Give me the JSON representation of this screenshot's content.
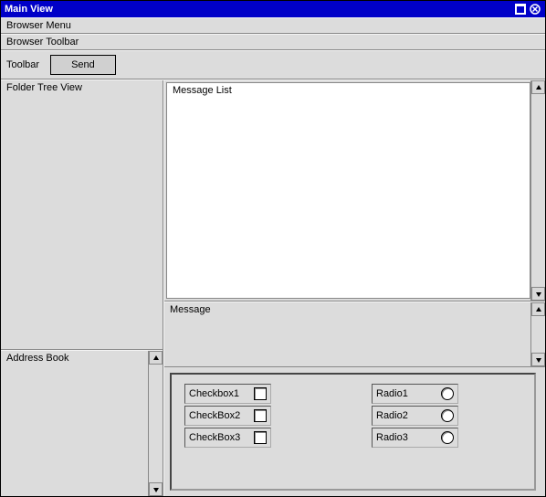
{
  "titlebar": {
    "title": "Main View"
  },
  "menubar": {
    "label": "Browser Menu"
  },
  "toolbar1": {
    "label": "Browser Toolbar"
  },
  "toolbar2": {
    "label": "Toolbar",
    "send_label": "Send"
  },
  "left": {
    "folder_tree_label": "Folder Tree View",
    "address_book_label": "Address Book"
  },
  "right": {
    "message_list_label": "Message List",
    "message_label": "Message"
  },
  "controls": {
    "checkboxes": [
      {
        "label": "Checkbox1"
      },
      {
        "label": "CheckBox2"
      },
      {
        "label": "CheckBox3"
      }
    ],
    "radios": [
      {
        "label": "Radio1"
      },
      {
        "label": "Radio2"
      },
      {
        "label": "Radio3"
      }
    ]
  }
}
